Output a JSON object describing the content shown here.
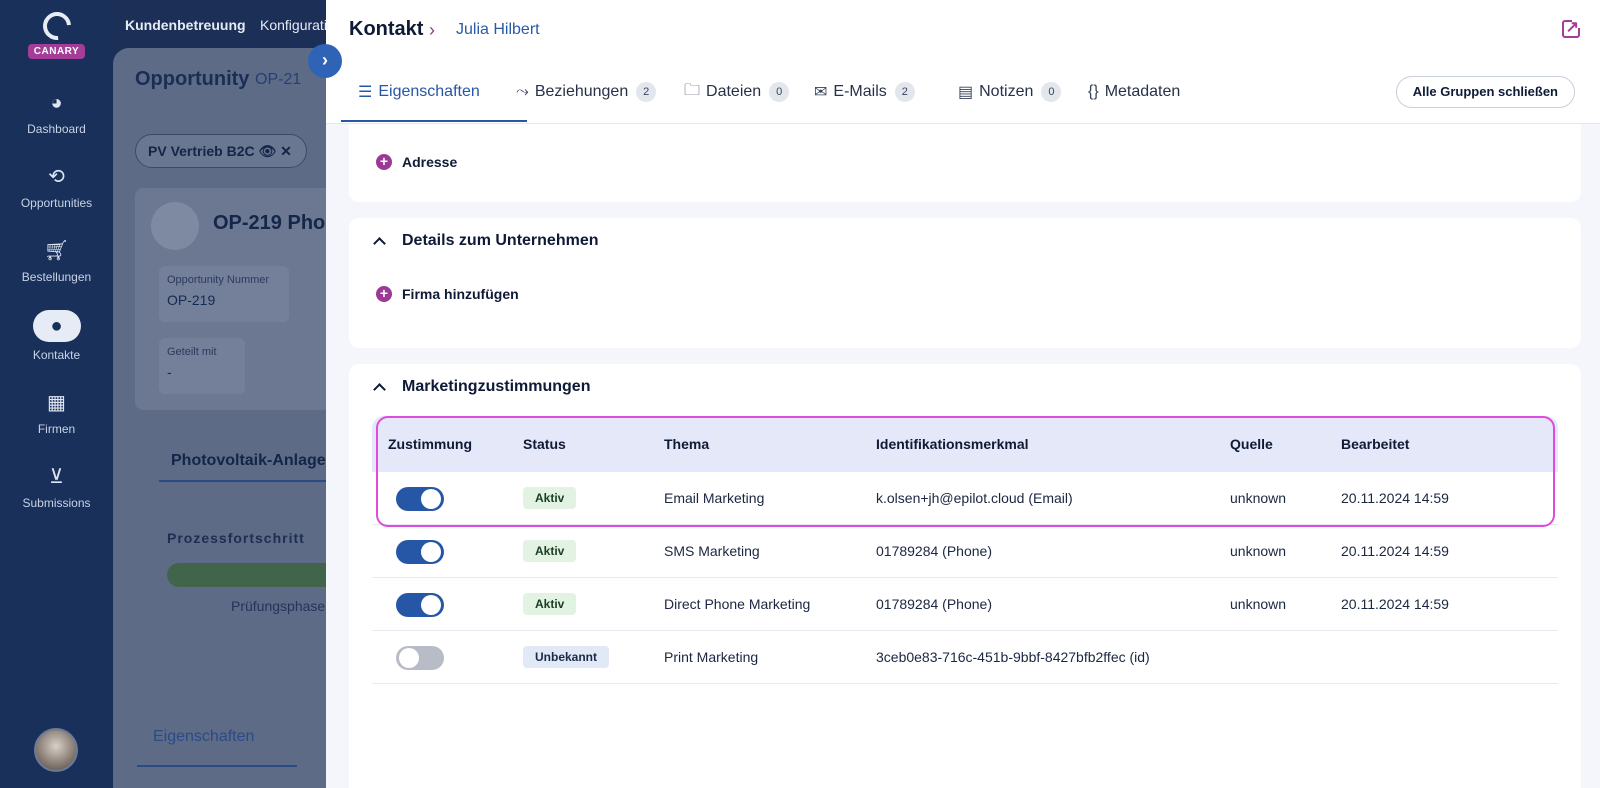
{
  "brand": {
    "badge": "CANARY"
  },
  "nav": {
    "items": [
      {
        "label": "Dashboard",
        "icon": "pie-chart-icon"
      },
      {
        "label": "Opportunities",
        "icon": "sync-icon"
      },
      {
        "label": "Bestellungen",
        "icon": "cart-icon"
      },
      {
        "label": "Kontakte",
        "icon": "person-icon"
      },
      {
        "label": "Firmen",
        "icon": "building-icon"
      },
      {
        "label": "Submissions",
        "icon": "inbox-icon"
      }
    ]
  },
  "background": {
    "topbar": [
      "Kundenbetreuung",
      "Konfiguratio"
    ],
    "title": "Opportunity",
    "crumb": "OP-21",
    "chip": "PV Vertrieb B2C",
    "op_title": "OP-219 Pho",
    "field1": {
      "label": "Opportunity Nummer",
      "value": "OP-219"
    },
    "field2": {
      "label": "Geteilt mit",
      "value": "-"
    },
    "tab": "Photovoltaik-Anlage",
    "process": "Prozessfortschritt",
    "phase": "Prüfungsphase",
    "bottom_tab": "Eigenschaften"
  },
  "drawer": {
    "title": "Kontakt",
    "crumb": "Julia Hilbert",
    "tabs": [
      {
        "label": "Eigenschaften",
        "icon": "list-icon",
        "count": null
      },
      {
        "label": "Beziehungen",
        "icon": "relations-icon",
        "count": "2"
      },
      {
        "label": "Dateien",
        "icon": "folder-icon",
        "count": "0"
      },
      {
        "label": "E-Mails",
        "icon": "mail-icon",
        "count": "2"
      },
      {
        "label": "Notizen",
        "icon": "note-icon",
        "count": "0"
      },
      {
        "label": "Metadaten",
        "icon": "braces-icon",
        "count": null
      }
    ],
    "close_groups": "Alle Gruppen schließen",
    "address_add": "Adresse",
    "company_group": "Details zum Unternehmen",
    "company_add": "Firma hinzufügen",
    "marketing_group": "Marketingzustimmungen",
    "table": {
      "headers": [
        "Zustimmung",
        "Status",
        "Thema",
        "Identifikationsmerkmal",
        "Quelle",
        "Bearbeitet"
      ],
      "rows": [
        {
          "consent": true,
          "status": "Aktiv",
          "status_color": "#e2f2e3",
          "topic": "Email Marketing",
          "id": "k.olsen+jh@epilot.cloud (Email)",
          "source": "unknown",
          "edited": "20.11.2024 14:59"
        },
        {
          "consent": true,
          "status": "Aktiv",
          "status_color": "#e2f2e3",
          "topic": "SMS Marketing",
          "id": "01789284 (Phone)",
          "source": "unknown",
          "edited": "20.11.2024 14:59"
        },
        {
          "consent": true,
          "status": "Aktiv",
          "status_color": "#e2f2e3",
          "topic": "Direct Phone Marketing",
          "id": "01789284 (Phone)",
          "source": "unknown",
          "edited": "20.11.2024 14:59"
        },
        {
          "consent": false,
          "status": "Unbekannt",
          "status_color": "#e1e8f6",
          "topic": "Print Marketing",
          "id": "3ceb0e83-716c-451b-9bbf-8427bfb2ffec (id)",
          "source": "",
          "edited": ""
        }
      ]
    }
  },
  "colors": {
    "nav_bg": "#18305a",
    "accent": "#2657a6",
    "brand": "#a43d98",
    "highlight": "#e04ae0"
  }
}
